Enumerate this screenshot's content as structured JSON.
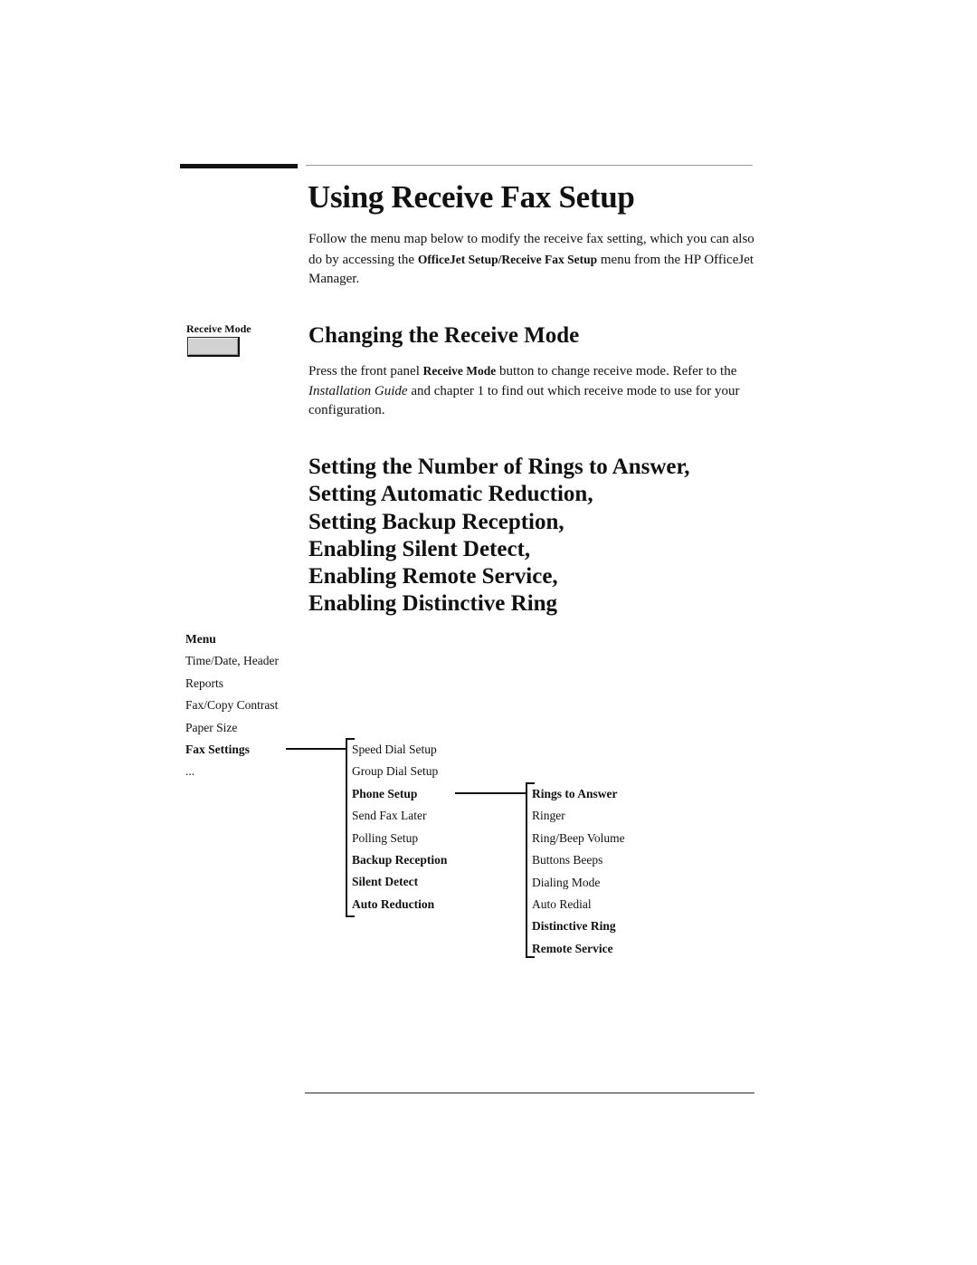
{
  "title": "Using Receive Fax Setup",
  "intro": {
    "text_before": " Follow the menu map below to modify the receive fax setting, which you can also do by accessing the ",
    "bold_path": "OfficeJet Setup/Receive Fax Setup",
    "text_after": " menu from the HP OfficeJet Manager."
  },
  "receive_mode_button": {
    "label": "Receive Mode"
  },
  "section_receive_mode": {
    "heading": "Changing the Receive Mode",
    "p_before": "Press the front panel ",
    "p_bold": "Receive Mode",
    "p_mid": " button to change receive mode. Refer to the ",
    "p_italic": "Installation Guide",
    "p_after": " and chapter 1 to find out which receive mode to use for your configuration."
  },
  "section_settings": {
    "heading_lines": [
      "Setting the Number of Rings to Answer,",
      "Setting Automatic Reduction,",
      "Setting Backup Reception,",
      "Enabling Silent Detect,",
      "Enabling Remote Service,",
      "Enabling Distinctive Ring"
    ]
  },
  "menu_map": {
    "menu": {
      "header": "Menu",
      "items": [
        {
          "label": "Time/Date, Header",
          "bold": false
        },
        {
          "label": "Reports",
          "bold": false
        },
        {
          "label": "Fax/Copy Contrast",
          "bold": false
        },
        {
          "label": "Paper Size",
          "bold": false
        },
        {
          "label": "Fax Settings",
          "bold": true
        },
        {
          "label": "...",
          "bold": false
        }
      ]
    },
    "fax_settings": {
      "items": [
        {
          "label": "Speed Dial Setup",
          "bold": false
        },
        {
          "label": "Group Dial Setup",
          "bold": false
        },
        {
          "label": "Phone Setup",
          "bold": true
        },
        {
          "label": "Send Fax Later",
          "bold": false
        },
        {
          "label": "Polling Setup",
          "bold": false
        },
        {
          "label": "Backup Reception",
          "bold": true
        },
        {
          "label": "Silent Detect",
          "bold": true
        },
        {
          "label": "Auto Reduction",
          "bold": true
        }
      ]
    },
    "phone_setup": {
      "items": [
        {
          "label": "Rings to Answer",
          "bold": true
        },
        {
          "label": "Ringer",
          "bold": false
        },
        {
          "label": "Ring/Beep Volume",
          "bold": false
        },
        {
          "label": "Buttons Beeps",
          "bold": false
        },
        {
          "label": "Dialing Mode",
          "bold": false
        },
        {
          "label": "Auto Redial",
          "bold": false
        },
        {
          "label": "Distinctive Ring",
          "bold": true
        },
        {
          "label": "Remote Service",
          "bold": true
        }
      ]
    }
  }
}
